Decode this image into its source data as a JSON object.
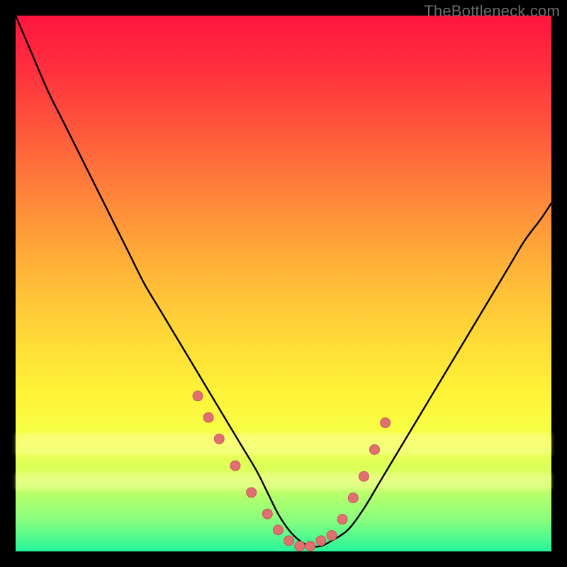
{
  "watermark": "TheBottleneck.com",
  "colors": {
    "curve": "#000000",
    "marker_fill": "#e07070",
    "marker_stroke": "#c85a5a",
    "frame_bg_top": "#ff153f",
    "frame_bg_bottom": "#24f59a",
    "page_bg": "#000000"
  },
  "chart_data": {
    "type": "line",
    "title": "",
    "xlabel": "",
    "ylabel": "",
    "xlim": [
      0,
      100
    ],
    "ylim": [
      0,
      100
    ],
    "grid": false,
    "legend": false,
    "series": [
      {
        "name": "curve",
        "x": [
          0,
          3,
          6,
          9,
          12,
          15,
          18,
          21,
          24,
          27,
          30,
          33,
          36,
          39,
          42,
          45,
          47,
          49,
          51,
          53,
          55,
          57,
          59,
          62,
          65,
          68,
          71,
          74,
          77,
          80,
          83,
          86,
          89,
          92,
          95,
          98,
          100
        ],
        "y": [
          100,
          93,
          86,
          80,
          74,
          68,
          62,
          56,
          50,
          45,
          40,
          35,
          30,
          25,
          20,
          15,
          11,
          7,
          4,
          2,
          1,
          1,
          2,
          4,
          8,
          13,
          18,
          23,
          28,
          33,
          38,
          43,
          48,
          53,
          58,
          62,
          65
        ]
      }
    ],
    "markers": {
      "name": "highlight-points",
      "x": [
        34,
        36,
        38,
        41,
        44,
        47,
        49,
        51,
        53,
        55,
        57,
        59,
        61,
        63,
        65,
        67,
        69
      ],
      "y": [
        29,
        25,
        21,
        16,
        11,
        7,
        4,
        2,
        1,
        1,
        2,
        3,
        6,
        10,
        14,
        19,
        24
      ]
    },
    "glow_bands": [
      {
        "y_center": 80,
        "height": 4
      },
      {
        "y_center": 87,
        "height": 3
      }
    ]
  }
}
